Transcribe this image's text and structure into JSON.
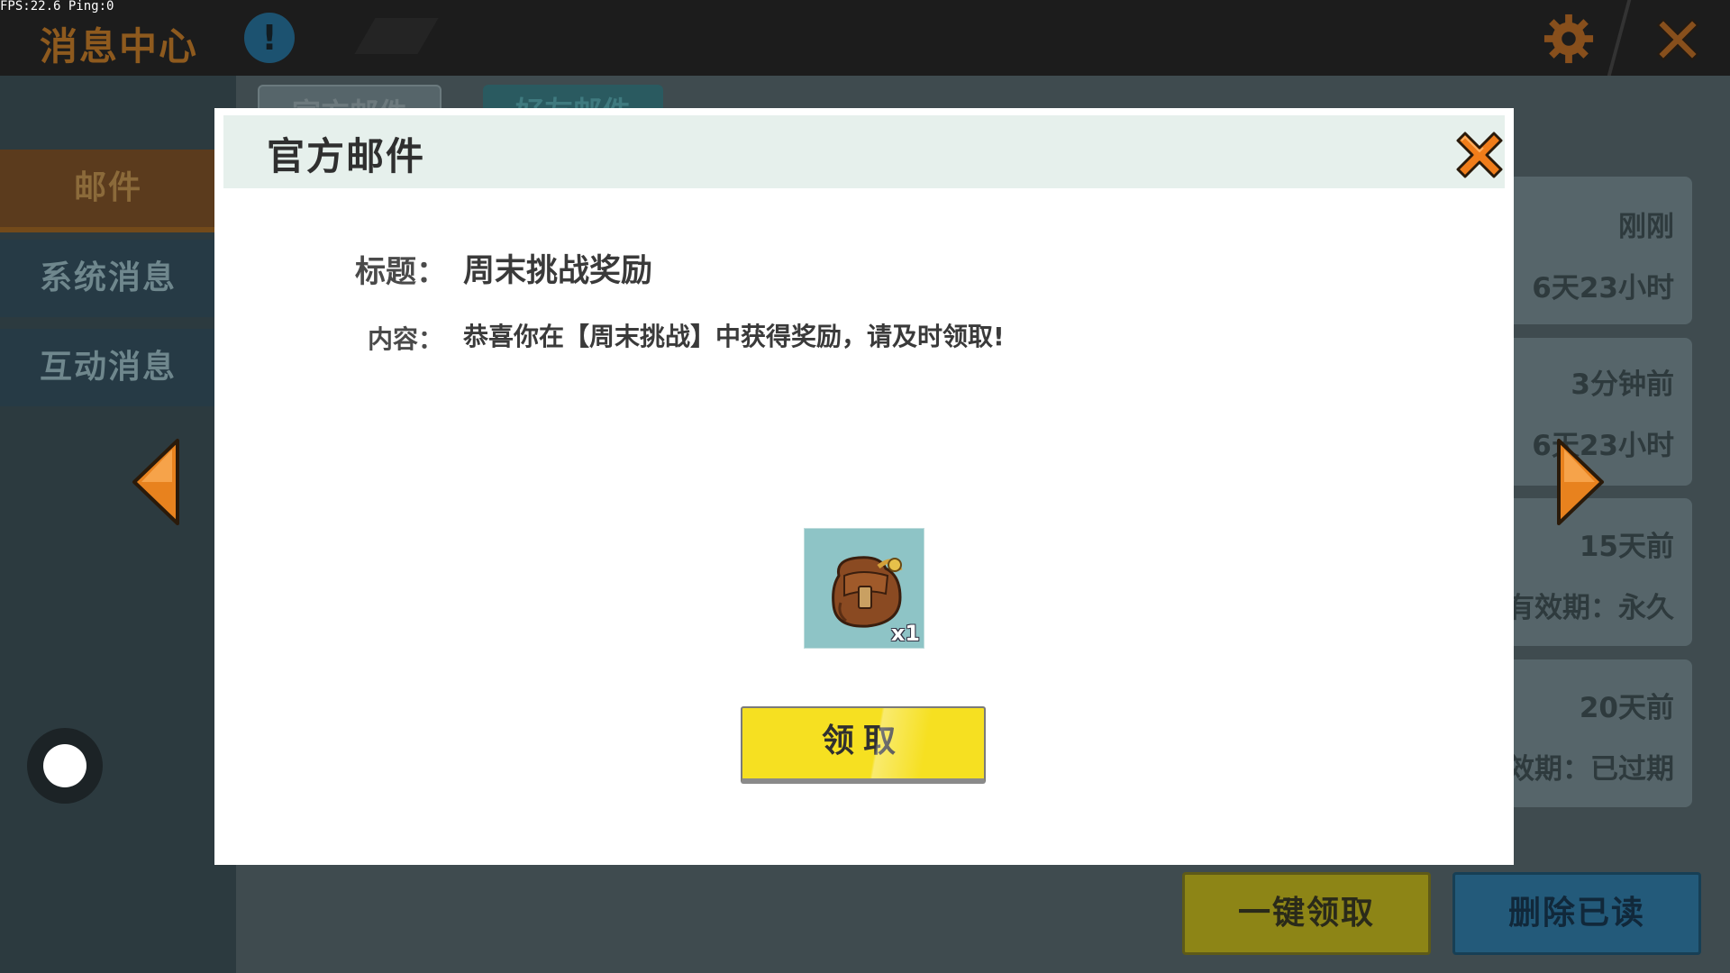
{
  "hud": {
    "fps_text": "FPS:22.6  Ping:0"
  },
  "topbar": {
    "title": "消息中心",
    "info_icon_glyph": "!",
    "icons": [
      "info-icon",
      "gear-icon",
      "close-icon"
    ]
  },
  "sidebar": {
    "items": [
      {
        "label": "邮件",
        "selected": true
      },
      {
        "label": "系统消息",
        "selected": false
      },
      {
        "label": "互动消息",
        "selected": false
      }
    ]
  },
  "main": {
    "tabs": [
      {
        "label": "官方邮件"
      },
      {
        "label": "好友邮件"
      }
    ],
    "mail_list": [
      {
        "time": "刚刚",
        "expire": "6天23小时"
      },
      {
        "time": "3分钟前",
        "expire": "6天23小时"
      },
      {
        "time": "15天前",
        "expire": "有效期：永久"
      },
      {
        "time": "20天前",
        "expire": "有效期：已过期"
      }
    ],
    "claim_all_label": "一键领取",
    "delete_read_label": "删除已读"
  },
  "modal": {
    "title": "官方邮件",
    "subject_label": "标题：",
    "subject_value": "周末挑战奖励",
    "content_label": "内容：",
    "content_value": "恭喜你在【周末挑战】中获得奖励，请及时领取!",
    "reward": {
      "icon": "backpack-icon",
      "quantity_text": "x1"
    },
    "claim_label": "领取"
  },
  "colors": {
    "accent_orange": "#f07d1a",
    "claim_yellow": "#f6e021",
    "modal_header_bg": "#e6f0ec",
    "reward_bg": "#8ec4c6"
  }
}
